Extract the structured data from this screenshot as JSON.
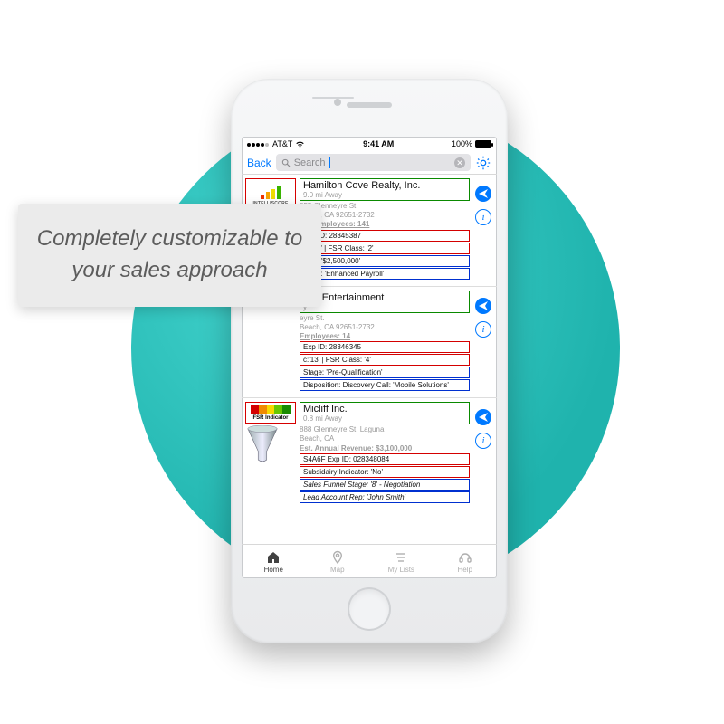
{
  "overlay": {
    "text": "Completely customizable to your sales approach"
  },
  "status": {
    "carrier": "AT&T",
    "time": "9:41 AM",
    "battery_pct": "100%"
  },
  "nav": {
    "back": "Back",
    "search_placeholder": "Search"
  },
  "cards": [
    {
      "thumb_label": "INTELLISCORE",
      "thumb_type": "bars",
      "name": "Hamilton Cove Realty, Inc.",
      "dist": "9.0 mi Away",
      "addr1": "855 Glenneyre St.",
      "addr2": "Beach, CA 92651-2732",
      "emp": "Est. Employees: 141",
      "exp": "Exp ID: 28345387",
      "score": "e: '54' | FSR Class: '2'",
      "size": "Size: '$2,500,000'",
      "aspect": "spect: 'Enhanced Payroll'"
    },
    {
      "thumb_label": "",
      "thumb_type": "none",
      "name": "ach Entertainment",
      "dist": "y",
      "addr1": "eyre St.",
      "addr2": "Beach, CA 92651-2732",
      "emp": "Employees: 14",
      "exp": "Exp ID: 28346345",
      "score": "c:'13' | FSR Class: '4'",
      "stage": "Stage: 'Pre-Qualification'",
      "disposition": "Disposition:  Discovery Call: 'Mobile Solutions'"
    },
    {
      "thumb_label": "FSR Indicator",
      "thumb_type": "fsr",
      "name": "Micliff Inc.",
      "dist": "0.8 mi Away",
      "addr1": "888 Glenneyre St. Laguna",
      "addr2": "Beach, CA",
      "rev": "Est. Annual Revenue: $3,100,000",
      "exp": "S4A6F  Exp ID: 028348084",
      "sub": "Subsidairy Indicator: 'No'",
      "stage": "Sales Funnel Stage: '8' - Negotiation",
      "rep": "Lead Account Rep: 'John Smith'"
    }
  ],
  "tabs": {
    "home": "Home",
    "map": "Map",
    "lists": "My Lists",
    "help": "Help"
  }
}
